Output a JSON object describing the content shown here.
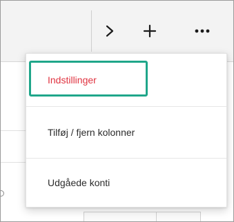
{
  "toolbar": {
    "next_icon": "chevron-right-icon",
    "add_icon": "plus-icon",
    "more_icon": "more-horizontal-icon"
  },
  "menu": {
    "items": [
      {
        "label": "Indstillinger",
        "highlighted": true
      },
      {
        "label": "Tilføj / fjern kolonner"
      },
      {
        "label": "Udgåede konti"
      }
    ]
  },
  "colors": {
    "highlight_border": "#1fa68a",
    "active_label": "#e0323f",
    "toolbar_bg": "#f3f3f3"
  }
}
